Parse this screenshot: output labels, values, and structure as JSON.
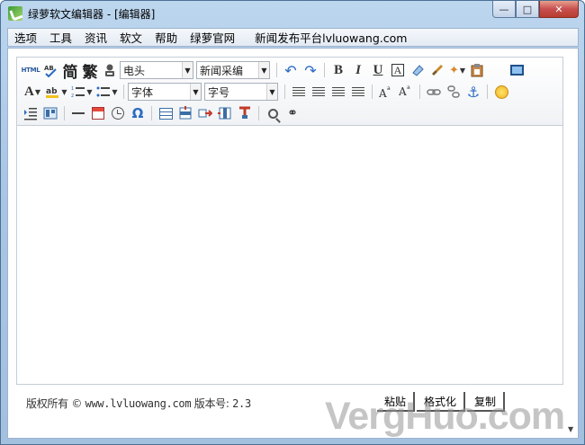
{
  "window": {
    "title": "绿萝软文编辑器 - [编辑器]",
    "minimize_glyph": "—",
    "maximize_glyph": "□",
    "close_glyph": "✕"
  },
  "menu": [
    {
      "label": "选项"
    },
    {
      "label": "工具"
    },
    {
      "label": "资讯"
    },
    {
      "label": "软文"
    },
    {
      "label": "帮助"
    },
    {
      "label": "绿萝官网"
    },
    {
      "label": "新闻发布平台lvluowang.com"
    }
  ],
  "toolbar": {
    "source_label": "HTML",
    "simplified_label": "简",
    "traditional_label": "繁",
    "header_select": "电头",
    "template_select": "新闻采编",
    "bold_label": "B",
    "italic_label": "I",
    "underline_label": "U",
    "font_color_label": "A",
    "font_select": "字体",
    "size_select": "字号",
    "special_char_label": "Ω"
  },
  "footer": {
    "copyright_prefix": "版权所有 © ",
    "site": "www.lvluowang.com",
    "version_label": " 版本号: ",
    "version": "2.3",
    "tabs": [
      {
        "label": "粘贴"
      },
      {
        "label": "格式化"
      },
      {
        "label": "复制"
      }
    ]
  },
  "watermark": "VergHuo.com",
  "icons": [
    "app-icon",
    "source-icon",
    "spellcheck-icon",
    "user-stamp-icon",
    "undo-icon",
    "redo-icon",
    "eraser-icon",
    "brush-icon",
    "magic-icon",
    "paste-icon",
    "monitor-icon",
    "highlight-icon",
    "ordered-list-icon",
    "unordered-list-icon",
    "align-left-icon",
    "align-center-icon",
    "align-right-icon",
    "justify-icon",
    "superscript-icon",
    "subscript-icon",
    "link-icon",
    "unlink-icon",
    "anchor-icon",
    "smiley-icon",
    "indent-icon",
    "layout-icon",
    "horizontal-rule-icon",
    "calendar-icon",
    "clock-icon",
    "table-icon",
    "insert-row-icon",
    "insert-col-icon",
    "merge-cells-icon",
    "split-cells-icon",
    "find-icon",
    "binoculars-icon"
  ]
}
